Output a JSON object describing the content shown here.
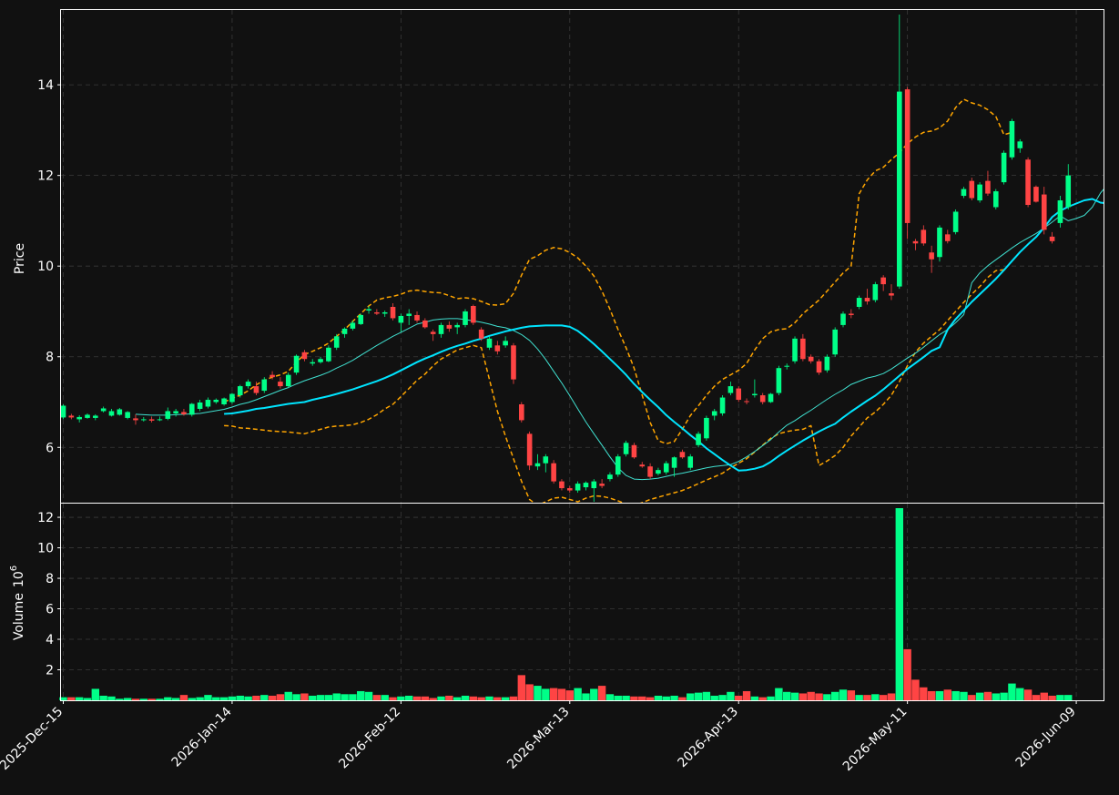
{
  "chart_data": {
    "type": "candlestick",
    "price_panel": {
      "ylabel": "Price",
      "ylim": [
        4.78,
        15.65
      ],
      "yticks": [
        6,
        8,
        10,
        12,
        14
      ],
      "grid": true
    },
    "volume_panel": {
      "ylabel": "Volume",
      "yexp_label": "10",
      "yexp_power": "6",
      "ylim": [
        0,
        12.9
      ],
      "yticks": [
        2,
        4,
        6,
        8,
        10,
        12
      ],
      "grid": true
    },
    "xticks": [
      {
        "index": 0,
        "label": "2025-Dec-15"
      },
      {
        "index": 21,
        "label": "2026-Jan-14"
      },
      {
        "index": 42,
        "label": "2026-Feb-12"
      },
      {
        "index": 63,
        "label": "2026-Mar-13"
      },
      {
        "index": 84,
        "label": "2026-Apr-13"
      },
      {
        "index": 105,
        "label": "2026-May-11"
      },
      {
        "index": 126,
        "label": "2026-Jun-09"
      }
    ],
    "n_bars": 130,
    "colors": {
      "up": "#00ff88",
      "down": "#ff4444",
      "ma_fast": "#40e0d0",
      "ma_slow": "#00e5ff",
      "bands": "#ffa500",
      "background": "#111111",
      "grid": "#3a3a3a",
      "axis": "#ffffff"
    },
    "ohlc": [
      [
        6.66,
        6.95,
        6.62,
        6.92
      ],
      [
        6.7,
        6.74,
        6.62,
        6.66
      ],
      [
        6.62,
        6.71,
        6.55,
        6.67
      ],
      [
        6.65,
        6.75,
        6.63,
        6.72
      ],
      [
        6.65,
        6.73,
        6.6,
        6.7
      ],
      [
        6.8,
        6.9,
        6.77,
        6.86
      ],
      [
        6.7,
        6.85,
        6.68,
        6.8
      ],
      [
        6.72,
        6.87,
        6.7,
        6.84
      ],
      [
        6.65,
        6.8,
        6.62,
        6.78
      ],
      [
        6.64,
        6.73,
        6.5,
        6.6
      ],
      [
        6.6,
        6.67,
        6.57,
        6.62
      ],
      [
        6.62,
        6.68,
        6.55,
        6.59
      ],
      [
        6.6,
        6.68,
        6.58,
        6.62
      ],
      [
        6.63,
        6.88,
        6.6,
        6.8
      ],
      [
        6.75,
        6.85,
        6.68,
        6.8
      ],
      [
        6.78,
        6.85,
        6.7,
        6.73
      ],
      [
        6.72,
        6.98,
        6.68,
        6.96
      ],
      [
        6.85,
        7.05,
        6.8,
        6.99
      ],
      [
        6.9,
        7.1,
        6.86,
        7.05
      ],
      [
        7.0,
        7.08,
        6.96,
        7.05
      ],
      [
        6.95,
        7.1,
        6.92,
        7.08
      ],
      [
        7.0,
        7.2,
        6.96,
        7.18
      ],
      [
        7.15,
        7.38,
        7.1,
        7.35
      ],
      [
        7.35,
        7.5,
        7.3,
        7.45
      ],
      [
        7.35,
        7.45,
        7.15,
        7.2
      ],
      [
        7.25,
        7.55,
        7.2,
        7.5
      ],
      [
        7.6,
        7.68,
        7.5,
        7.55
      ],
      [
        7.45,
        7.55,
        7.3,
        7.35
      ],
      [
        7.35,
        7.65,
        7.32,
        7.6
      ],
      [
        7.65,
        8.05,
        7.6,
        8.02
      ],
      [
        8.1,
        8.15,
        7.9,
        7.95
      ],
      [
        7.85,
        7.95,
        7.8,
        7.88
      ],
      [
        7.88,
        8.0,
        7.85,
        7.95
      ],
      [
        7.9,
        8.25,
        7.88,
        8.2
      ],
      [
        8.2,
        8.5,
        8.15,
        8.45
      ],
      [
        8.5,
        8.65,
        8.42,
        8.62
      ],
      [
        8.62,
        8.8,
        8.58,
        8.75
      ],
      [
        8.72,
        8.95,
        8.7,
        8.92
      ],
      [
        9.02,
        9.12,
        8.95,
        9.05
      ],
      [
        8.98,
        9.05,
        8.92,
        8.95
      ],
      [
        8.95,
        9.02,
        8.88,
        8.98
      ],
      [
        9.1,
        9.18,
        8.8,
        8.85
      ],
      [
        8.75,
        8.95,
        8.55,
        8.9
      ],
      [
        8.9,
        9.05,
        8.7,
        8.95
      ],
      [
        8.92,
        9.0,
        8.75,
        8.8
      ],
      [
        8.8,
        8.85,
        8.62,
        8.65
      ],
      [
        8.55,
        8.6,
        8.35,
        8.5
      ],
      [
        8.5,
        8.75,
        8.42,
        8.7
      ],
      [
        8.7,
        8.78,
        8.55,
        8.62
      ],
      [
        8.65,
        8.75,
        8.5,
        8.7
      ],
      [
        8.7,
        9.05,
        8.65,
        9.0
      ],
      [
        9.12,
        9.15,
        8.7,
        8.75
      ],
      [
        8.6,
        8.65,
        8.35,
        8.4
      ],
      [
        8.2,
        8.45,
        8.15,
        8.4
      ],
      [
        8.25,
        8.35,
        8.05,
        8.12
      ],
      [
        8.25,
        8.45,
        8.2,
        8.35
      ],
      [
        8.25,
        8.3,
        7.4,
        7.5
      ],
      [
        6.95,
        7.0,
        6.55,
        6.6
      ],
      [
        6.3,
        6.35,
        5.5,
        5.6
      ],
      [
        5.58,
        5.85,
        5.5,
        5.65
      ],
      [
        5.65,
        5.85,
        5.45,
        5.8
      ],
      [
        5.65,
        5.72,
        5.2,
        5.25
      ],
      [
        5.25,
        5.3,
        5.05,
        5.1
      ],
      [
        5.1,
        5.15,
        5.0,
        5.05
      ],
      [
        5.05,
        5.25,
        5.0,
        5.2
      ],
      [
        5.12,
        5.25,
        5.05,
        5.22
      ],
      [
        5.1,
        5.3,
        4.8,
        5.25
      ],
      [
        5.2,
        5.3,
        5.1,
        5.15
      ],
      [
        5.3,
        5.45,
        5.25,
        5.4
      ],
      [
        5.4,
        5.85,
        5.35,
        5.8
      ],
      [
        5.85,
        6.15,
        5.8,
        6.1
      ],
      [
        6.05,
        6.1,
        5.75,
        5.78
      ],
      [
        5.62,
        5.68,
        5.55,
        5.58
      ],
      [
        5.58,
        5.65,
        5.3,
        5.35
      ],
      [
        5.42,
        5.55,
        5.38,
        5.5
      ],
      [
        5.45,
        5.7,
        5.4,
        5.65
      ],
      [
        5.55,
        5.8,
        5.35,
        5.78
      ],
      [
        5.9,
        5.95,
        5.75,
        5.78
      ],
      [
        5.55,
        5.85,
        5.5,
        5.8
      ],
      [
        6.05,
        6.35,
        6.0,
        6.3
      ],
      [
        6.2,
        6.7,
        6.15,
        6.65
      ],
      [
        6.7,
        6.85,
        6.6,
        6.8
      ],
      [
        6.75,
        7.15,
        6.7,
        7.1
      ],
      [
        7.2,
        7.45,
        7.15,
        7.35
      ],
      [
        7.3,
        7.35,
        7.0,
        7.05
      ],
      [
        7.02,
        7.08,
        6.95,
        7.0
      ],
      [
        7.15,
        7.5,
        7.1,
        7.18
      ],
      [
        7.15,
        7.2,
        6.95,
        7.0
      ],
      [
        7.0,
        7.2,
        6.98,
        7.18
      ],
      [
        7.2,
        7.8,
        7.15,
        7.75
      ],
      [
        7.78,
        7.85,
        7.72,
        7.8
      ],
      [
        7.9,
        8.45,
        7.85,
        8.4
      ],
      [
        8.4,
        8.5,
        7.9,
        7.95
      ],
      [
        8.0,
        8.05,
        7.85,
        7.9
      ],
      [
        7.9,
        7.95,
        7.6,
        7.65
      ],
      [
        7.7,
        8.05,
        7.65,
        8.0
      ],
      [
        8.05,
        8.65,
        8.0,
        8.6
      ],
      [
        8.7,
        9.0,
        8.65,
        8.95
      ],
      [
        8.95,
        9.05,
        8.85,
        8.92
      ],
      [
        9.1,
        9.35,
        9.05,
        9.3
      ],
      [
        9.3,
        9.5,
        9.15,
        9.22
      ],
      [
        9.25,
        9.65,
        9.2,
        9.6
      ],
      [
        9.75,
        9.8,
        9.45,
        9.6
      ],
      [
        9.4,
        9.6,
        9.25,
        9.35
      ],
      [
        9.55,
        15.55,
        9.5,
        13.85
      ],
      [
        13.9,
        13.95,
        10.6,
        10.95
      ],
      [
        10.55,
        10.6,
        10.35,
        10.5
      ],
      [
        10.8,
        10.9,
        10.45,
        10.5
      ],
      [
        10.3,
        10.45,
        9.85,
        10.15
      ],
      [
        10.2,
        10.9,
        10.1,
        10.85
      ],
      [
        10.7,
        10.8,
        10.5,
        10.55
      ],
      [
        10.75,
        11.25,
        10.7,
        11.2
      ],
      [
        11.55,
        11.75,
        11.5,
        11.7
      ],
      [
        11.88,
        11.95,
        11.45,
        11.5
      ],
      [
        11.45,
        11.85,
        11.4,
        11.8
      ],
      [
        11.88,
        12.1,
        11.55,
        11.6
      ],
      [
        11.3,
        11.7,
        11.25,
        11.65
      ],
      [
        11.85,
        12.55,
        11.8,
        12.5
      ],
      [
        12.4,
        13.25,
        12.35,
        13.2
      ],
      [
        12.6,
        12.8,
        12.5,
        12.75
      ],
      [
        12.35,
        12.4,
        11.3,
        11.35
      ],
      [
        11.75,
        11.78,
        11.4,
        11.42
      ],
      [
        11.58,
        11.75,
        10.7,
        10.8
      ],
      [
        10.65,
        10.75,
        10.5,
        10.55
      ],
      [
        10.95,
        11.55,
        10.85,
        11.45
      ],
      [
        11.3,
        12.25,
        11.25,
        12.0
      ]
    ],
    "volume": [
      0.2,
      0.2,
      0.2,
      0.15,
      0.75,
      0.3,
      0.25,
      0.1,
      0.15,
      0.1,
      0.1,
      0.1,
      0.1,
      0.2,
      0.15,
      0.35,
      0.15,
      0.2,
      0.35,
      0.2,
      0.2,
      0.25,
      0.3,
      0.25,
      0.3,
      0.35,
      0.3,
      0.4,
      0.55,
      0.4,
      0.45,
      0.3,
      0.35,
      0.35,
      0.45,
      0.4,
      0.4,
      0.6,
      0.55,
      0.35,
      0.35,
      0.2,
      0.25,
      0.3,
      0.25,
      0.25,
      0.15,
      0.25,
      0.3,
      0.2,
      0.3,
      0.25,
      0.2,
      0.25,
      0.2,
      0.2,
      0.25,
      1.65,
      1.05,
      0.95,
      0.75,
      0.8,
      0.75,
      0.65,
      0.8,
      0.45,
      0.75,
      0.95,
      0.4,
      0.3,
      0.3,
      0.25,
      0.25,
      0.2,
      0.3,
      0.25,
      0.3,
      0.2,
      0.45,
      0.5,
      0.55,
      0.3,
      0.35,
      0.55,
      0.3,
      0.6,
      0.25,
      0.2,
      0.25,
      0.8,
      0.55,
      0.5,
      0.45,
      0.55,
      0.45,
      0.4,
      0.55,
      0.7,
      0.65,
      0.35,
      0.35,
      0.4,
      0.35,
      0.45,
      12.6,
      3.35,
      1.35,
      0.85,
      0.6,
      0.6,
      0.7,
      0.6,
      0.55,
      0.35,
      0.5,
      0.55,
      0.45,
      0.5,
      1.1,
      0.8,
      0.7,
      0.35,
      0.5,
      0.3,
      0.35,
      0.35
    ],
    "ma_fast_start": 9,
    "ma_fast": [
      6.73,
      6.72,
      6.71,
      6.71,
      6.71,
      6.72,
      6.73,
      6.74,
      6.75,
      6.78,
      6.81,
      6.84,
      6.89,
      6.95,
      6.99,
      7.05,
      7.12,
      7.19,
      7.26,
      7.32,
      7.4,
      7.47,
      7.53,
      7.59,
      7.66,
      7.75,
      7.83,
      7.92,
      8.03,
      8.14,
      8.25,
      8.35,
      8.45,
      8.54,
      8.63,
      8.72,
      8.76,
      8.81,
      8.83,
      8.84,
      8.84,
      8.82,
      8.79,
      8.76,
      8.72,
      8.67,
      8.64,
      8.58,
      8.49,
      8.36,
      8.17,
      7.94,
      7.68,
      7.42,
      7.14,
      6.85,
      6.56,
      6.3,
      6.05,
      5.79,
      5.55,
      5.38,
      5.3,
      5.29,
      5.3,
      5.32,
      5.36,
      5.4,
      5.43,
      5.47,
      5.51,
      5.55,
      5.58,
      5.6,
      5.62,
      5.69,
      5.79,
      5.91,
      6.04,
      6.17,
      6.34,
      6.49,
      6.59,
      6.71,
      6.82,
      6.94,
      7.06,
      7.17,
      7.27,
      7.39,
      7.46,
      7.53,
      7.57,
      7.63,
      7.73,
      7.85,
      7.97,
      8.08,
      8.21,
      8.35,
      8.49,
      8.6,
      8.75,
      8.93,
      9.63,
      9.85,
      10.01,
      10.14,
      10.27,
      10.4,
      10.52,
      10.62,
      10.72,
      10.84,
      10.97,
      11.11,
      11.0,
      11.05,
      11.12,
      11.3,
      11.61,
      11.82,
      11.92,
      11.95,
      11.85,
      11.76,
      11.72,
      11.72
    ],
    "ma_slow_start": 20,
    "ma_slow": [
      6.74,
      6.75,
      6.78,
      6.81,
      6.85,
      6.87,
      6.9,
      6.93,
      6.96,
      6.98,
      7.0,
      7.05,
      7.09,
      7.13,
      7.18,
      7.23,
      7.28,
      7.34,
      7.4,
      7.46,
      7.53,
      7.61,
      7.7,
      7.79,
      7.88,
      7.96,
      8.03,
      8.11,
      8.18,
      8.24,
      8.29,
      8.35,
      8.4,
      8.46,
      8.51,
      8.56,
      8.6,
      8.64,
      8.67,
      8.68,
      8.69,
      8.69,
      8.69,
      8.66,
      8.57,
      8.43,
      8.28,
      8.12,
      7.95,
      7.78,
      7.6,
      7.4,
      7.22,
      7.05,
      6.89,
      6.71,
      6.56,
      6.42,
      6.27,
      6.13,
      5.98,
      5.85,
      5.72,
      5.6,
      5.49,
      5.5,
      5.53,
      5.58,
      5.68,
      5.81,
      5.93,
      6.04,
      6.15,
      6.25,
      6.35,
      6.44,
      6.52,
      6.66,
      6.79,
      6.91,
      7.03,
      7.14,
      7.28,
      7.43,
      7.58,
      7.73,
      7.86,
      7.99,
      8.13,
      8.21,
      8.6,
      8.83,
      9.02,
      9.21,
      9.38,
      9.55,
      9.72,
      9.91,
      10.11,
      10.31,
      10.48,
      10.64,
      10.85,
      11.08,
      11.22,
      11.31,
      11.38,
      11.45,
      11.48,
      11.4,
      11.38
    ],
    "bb_start": 20,
    "bb_upper": [
      7.0,
      7.08,
      7.15,
      7.25,
      7.38,
      7.48,
      7.55,
      7.6,
      7.68,
      7.88,
      8.05,
      8.12,
      8.2,
      8.3,
      8.45,
      8.6,
      8.78,
      8.95,
      9.12,
      9.25,
      9.3,
      9.33,
      9.38,
      9.45,
      9.47,
      9.44,
      9.42,
      9.41,
      9.35,
      9.28,
      9.3,
      9.28,
      9.22,
      9.15,
      9.14,
      9.17,
      9.4,
      9.8,
      10.15,
      10.23,
      10.35,
      10.41,
      10.38,
      10.3,
      10.18,
      10.0,
      9.78,
      9.45,
      9.05,
      8.6,
      8.2,
      7.75,
      7.15,
      6.55,
      6.15,
      6.08,
      6.13,
      6.4,
      6.7,
      6.92,
      7.15,
      7.35,
      7.5,
      7.6,
      7.7,
      7.85,
      8.15,
      8.4,
      8.55,
      8.6,
      8.62,
      8.75,
      8.95,
      9.1,
      9.25,
      9.45,
      9.65,
      9.85,
      10.0,
      11.6,
      11.9,
      12.1,
      12.18,
      12.35,
      12.5,
      12.7,
      12.85,
      12.95,
      12.98,
      13.05,
      13.2,
      13.5,
      13.68,
      13.6,
      13.55,
      13.45,
      13.3,
      12.9,
      12.95
    ],
    "bb_lower": [
      6.48,
      6.47,
      6.43,
      6.42,
      6.4,
      6.38,
      6.36,
      6.35,
      6.34,
      6.32,
      6.3,
      6.35,
      6.4,
      6.45,
      6.47,
      6.48,
      6.5,
      6.55,
      6.62,
      6.72,
      6.85,
      6.95,
      7.12,
      7.3,
      7.48,
      7.62,
      7.8,
      7.95,
      8.05,
      8.15,
      8.2,
      8.25,
      8.2,
      7.5,
      6.8,
      6.25,
      5.75,
      5.25,
      4.85,
      4.72,
      4.8,
      4.88,
      4.9,
      4.85,
      4.8,
      4.88,
      4.93,
      4.92,
      4.88,
      4.82,
      4.75,
      4.72,
      4.78,
      4.85,
      4.9,
      4.95,
      5.0,
      5.05,
      5.12,
      5.2,
      5.28,
      5.35,
      5.43,
      5.55,
      5.65,
      5.75,
      5.9,
      6.05,
      6.2,
      6.3,
      6.35,
      6.38,
      6.4,
      6.48,
      5.6,
      5.7,
      5.82,
      6.0,
      6.25,
      6.45,
      6.65,
      6.78,
      6.95,
      7.15,
      7.45,
      7.8,
      8.1,
      8.3,
      8.45,
      8.6,
      8.8,
      9.0,
      9.2,
      9.38,
      9.55,
      9.75,
      9.9,
      9.92
    ]
  }
}
